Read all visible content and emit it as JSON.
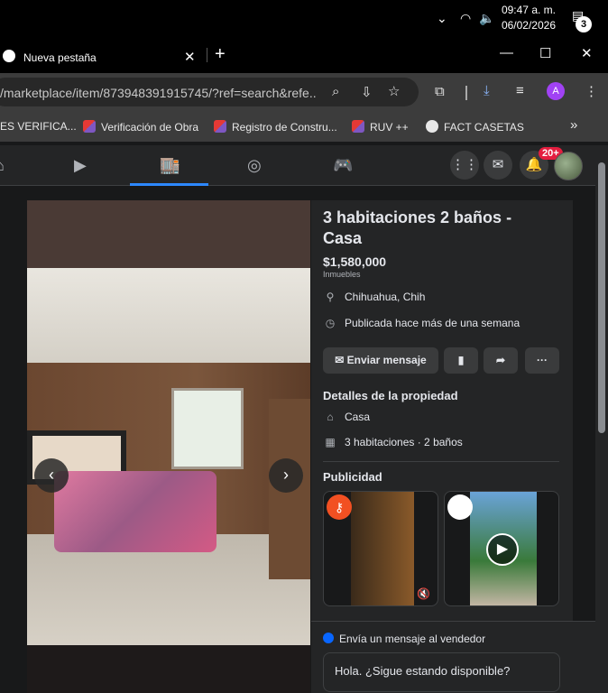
{
  "taskbar": {
    "time": "09:47 a. m.",
    "date": "06/02/2026",
    "notifications": "3"
  },
  "browser": {
    "tab_title": "Nueva pestaña",
    "url": "/marketplace/item/873948391915745/?ref=search&refe...",
    "profile_initial": "A",
    "bookmarks": [
      {
        "label": "ES VERIFICA..."
      },
      {
        "label": "Verificación de Obra"
      },
      {
        "label": "Registro de Constru..."
      },
      {
        "label": "RUV ++"
      },
      {
        "label": "FACT CASETAS"
      }
    ],
    "bookmarks_more": "»"
  },
  "facebook_nav": {
    "notification_count": "20+"
  },
  "listing": {
    "title": "3 habitaciones 2 baños - Casa",
    "price": "$1,580,000",
    "category": "Inmuebles",
    "location": "Chihuahua, Chih",
    "published": "Publicada hace más de una semana",
    "send_message_label": "Enviar mensaje",
    "details_heading": "Detalles de la propiedad",
    "property_type": "Casa",
    "rooms": "3 habitaciones · 2 baños",
    "ads_heading": "Publicidad"
  },
  "message_panel": {
    "header": "Envía un mensaje al vendedor",
    "input_value": "Hola. ¿Sigue estando disponible?"
  },
  "colors": {
    "accent": "#2d88ff",
    "badge": "#e41e3f",
    "panel": "#242526",
    "background": "#18191a"
  }
}
